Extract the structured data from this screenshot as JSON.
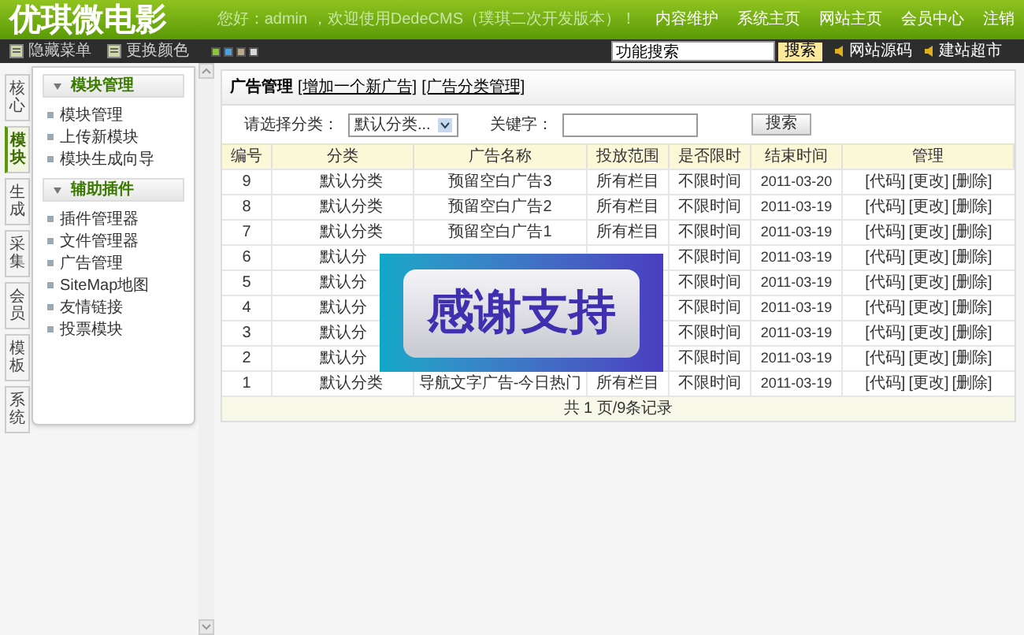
{
  "header": {
    "logo": "优琪微电影",
    "welcome": "您好：admin ，欢迎使用DedeCMS（璞琪二次开发版本）！",
    "links": [
      "内容维护",
      "系统主页",
      "网站主页",
      "会员中心",
      "注销"
    ]
  },
  "toolbar": {
    "items": [
      {
        "label": "隐藏菜单"
      },
      {
        "label": "更换颜色"
      }
    ],
    "swatches": [
      {
        "color": "#8cc63f"
      },
      {
        "color": "#4aa3df"
      },
      {
        "color": "#b8a98a"
      },
      {
        "color": "#d8d8d8"
      }
    ],
    "search": {
      "value": "功能搜索"
    },
    "search_button": "搜索",
    "links": [
      "网站源码",
      "建站超市"
    ]
  },
  "side_tabs": [
    {
      "label": "核心",
      "selected": false
    },
    {
      "label": "模块",
      "selected": true
    },
    {
      "label": "生成",
      "selected": false
    },
    {
      "label": "采集",
      "selected": false
    },
    {
      "label": "会员",
      "selected": false
    },
    {
      "label": "模板",
      "selected": false
    },
    {
      "label": "系统",
      "selected": false
    }
  ],
  "sidebar": {
    "sections": [
      {
        "title": "模块管理",
        "items": [
          "模块管理",
          "上传新模块",
          "模块生成向导"
        ]
      },
      {
        "title": "辅助插件",
        "items": [
          "插件管理器",
          "文件管理器",
          "广告管理",
          "SiteMap地图",
          "友情链接",
          "投票模块"
        ]
      }
    ]
  },
  "panel": {
    "title": "广告管理",
    "links": [
      "[增加一个新广告]",
      "[广告分类管理]"
    ],
    "filter": {
      "category_label": "请选择分类：",
      "category_value": "默认分类...",
      "keyword_label": "关键字：",
      "button": "搜索"
    },
    "table": {
      "columns": [
        "编号",
        "分类",
        "广告名称",
        "投放范围",
        "是否限时",
        "结束时间",
        "管理"
      ],
      "rows": [
        {
          "id": "9",
          "category": "默认分类",
          "name": "预留空白广告3",
          "scope": "所有栏目",
          "limit": "不限时间",
          "end": "2011-03-20",
          "actions": [
            "[代码]",
            "[更改]",
            "[删除]"
          ]
        },
        {
          "id": "8",
          "category": "默认分类",
          "name": "预留空白广告2",
          "scope": "所有栏目",
          "limit": "不限时间",
          "end": "2011-03-19",
          "actions": [
            "[代码]",
            "[更改]",
            "[删除]"
          ]
        },
        {
          "id": "7",
          "category": "默认分类",
          "name": "预留空白广告1",
          "scope": "所有栏目",
          "limit": "不限时间",
          "end": "2011-03-19",
          "actions": [
            "[代码]",
            "[更改]",
            "[删除]"
          ]
        },
        {
          "id": "6",
          "category": "默认分",
          "limit": "不限时间",
          "end": "2011-03-19",
          "actions": [
            "[代码]",
            "[更改]",
            "[删除]"
          ]
        },
        {
          "id": "5",
          "category": "默认分",
          "limit": "不限时间",
          "end": "2011-03-19",
          "actions": [
            "[代码]",
            "[更改]",
            "[删除]"
          ]
        },
        {
          "id": "4",
          "category": "默认分",
          "limit": "不限时间",
          "end": "2011-03-19",
          "actions": [
            "[代码]",
            "[更改]",
            "[删除]"
          ]
        },
        {
          "id": "3",
          "category": "默认分",
          "limit": "不限时间",
          "end": "2011-03-19",
          "actions": [
            "[代码]",
            "[更改]",
            "[删除]"
          ]
        },
        {
          "id": "2",
          "category": "默认分",
          "limit": "不限时间",
          "end": "2011-03-19",
          "actions": [
            "[代码]",
            "[更改]",
            "[删除]"
          ]
        },
        {
          "id": "1",
          "category": "默认分类",
          "name": "导航文字广告-今日热门",
          "scope": "所有栏目",
          "limit": "不限时间",
          "end": "2011-03-19",
          "actions": [
            "[代码]",
            "[更改]",
            "[删除]"
          ]
        }
      ]
    },
    "pagination": "共 1 页/9条记录"
  },
  "banner": {
    "text": "感谢支持"
  }
}
